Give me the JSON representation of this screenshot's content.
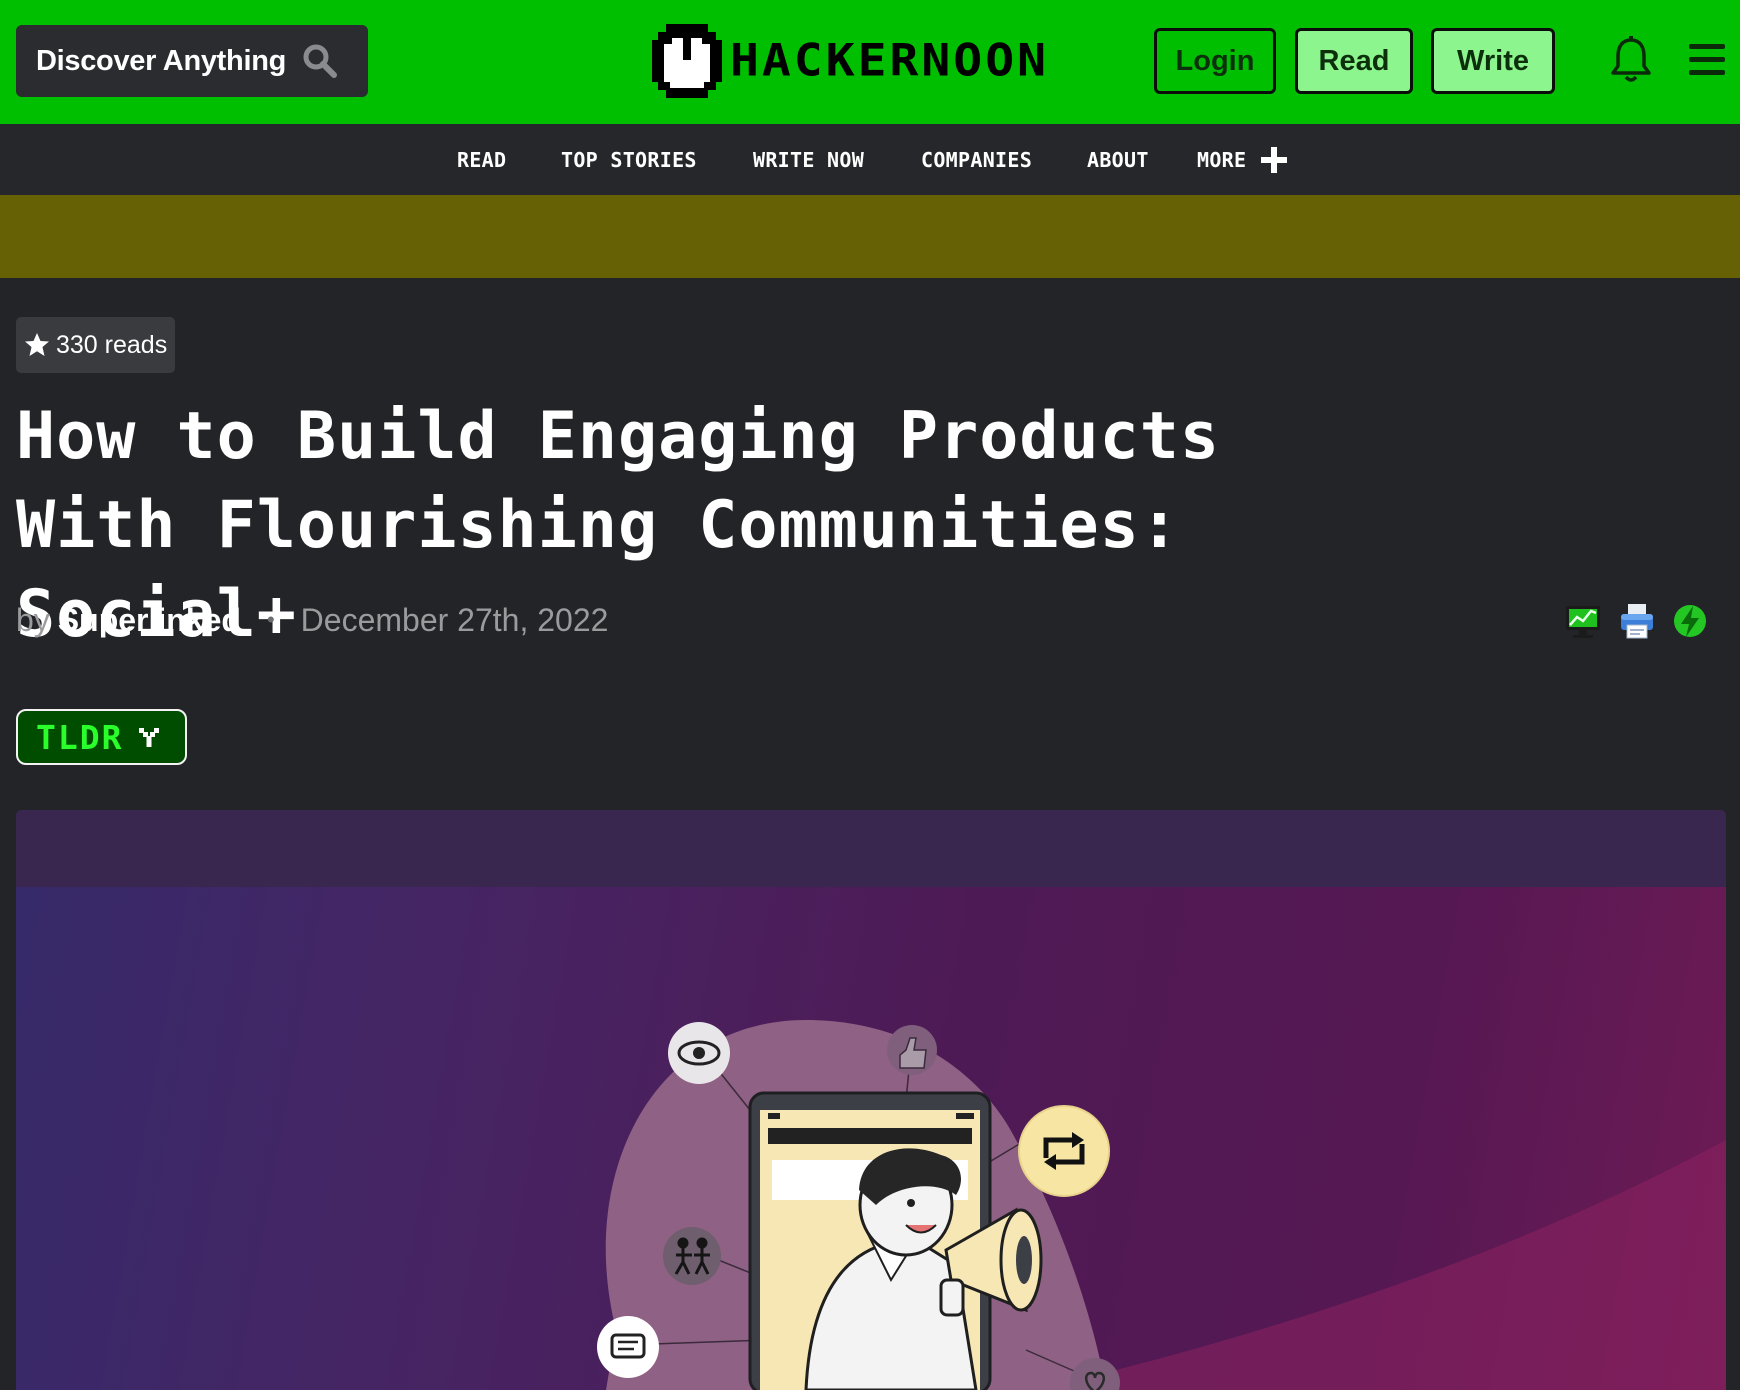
{
  "header": {
    "search_label": "Discover Anything",
    "logo_text": "HACKERNOON",
    "login_label": "Login",
    "read_label": "Read",
    "write_label": "Write"
  },
  "nav": {
    "items": [
      "READ",
      "TOP STORIES",
      "WRITE NOW",
      "COMPANIES",
      "ABOUT",
      "MORE"
    ]
  },
  "article": {
    "reads": "330 reads",
    "title": "How to Build Engaging Products With Flourishing Communities: Social+",
    "by": "by",
    "author": "Superlinked",
    "date": "December 27th, 2022",
    "tldr_label": "TLDR"
  },
  "icons": {
    "search": "search-icon",
    "bell": "bell-icon",
    "menu": "hamburger-menu-icon",
    "plus": "plus-icon",
    "star": "star-icon",
    "screen": "screen-mode-icon",
    "print": "print-icon",
    "bolt": "lightning-icon",
    "chevron": "chevron-down-icon"
  },
  "colors": {
    "brand_green": "#00be00",
    "light_green": "#8df58d",
    "nav_bg": "#26272b",
    "ad_band": "#676105",
    "page_bg": "#232427"
  }
}
